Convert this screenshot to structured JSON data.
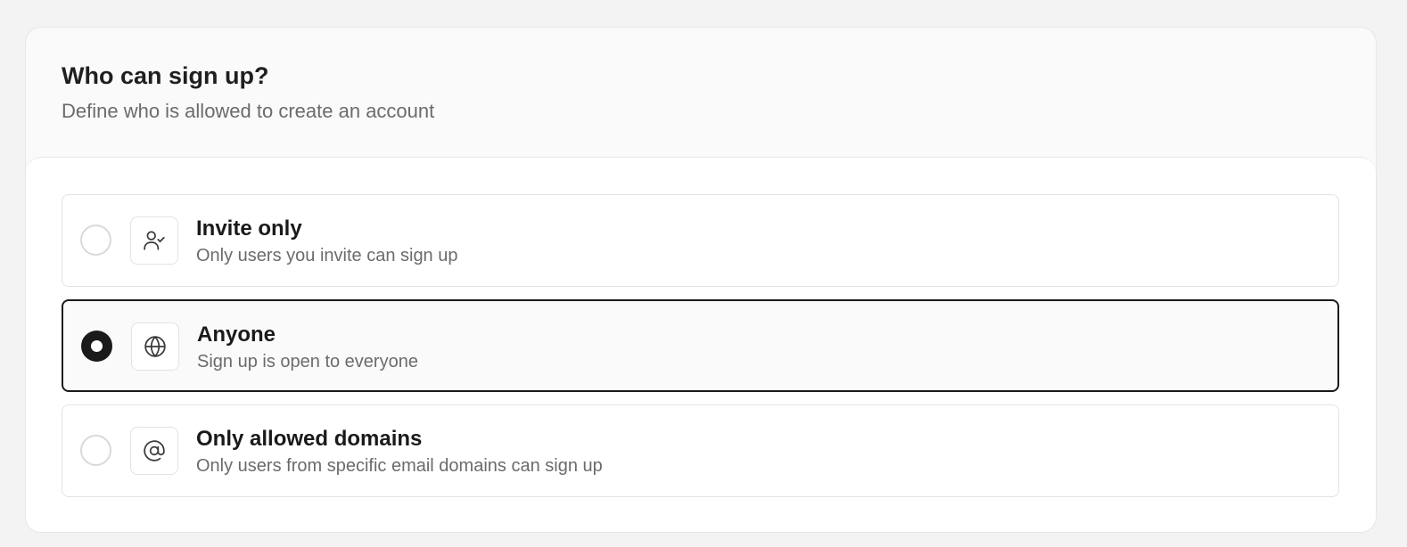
{
  "section": {
    "title": "Who can sign up?",
    "subtitle": "Define who is allowed to create an account"
  },
  "options": [
    {
      "title": "Invite only",
      "description": "Only users you invite can sign up",
      "icon": "user-check-icon",
      "selected": false
    },
    {
      "title": "Anyone",
      "description": "Sign up is open to everyone",
      "icon": "globe-icon",
      "selected": true
    },
    {
      "title": "Only allowed domains",
      "description": "Only users from specific email domains can sign up",
      "icon": "at-sign-icon",
      "selected": false
    }
  ],
  "colors": {
    "selected_border": "#1a1a1a",
    "unselected_border": "#e3e3e3",
    "muted_text": "#6b6b6b"
  }
}
